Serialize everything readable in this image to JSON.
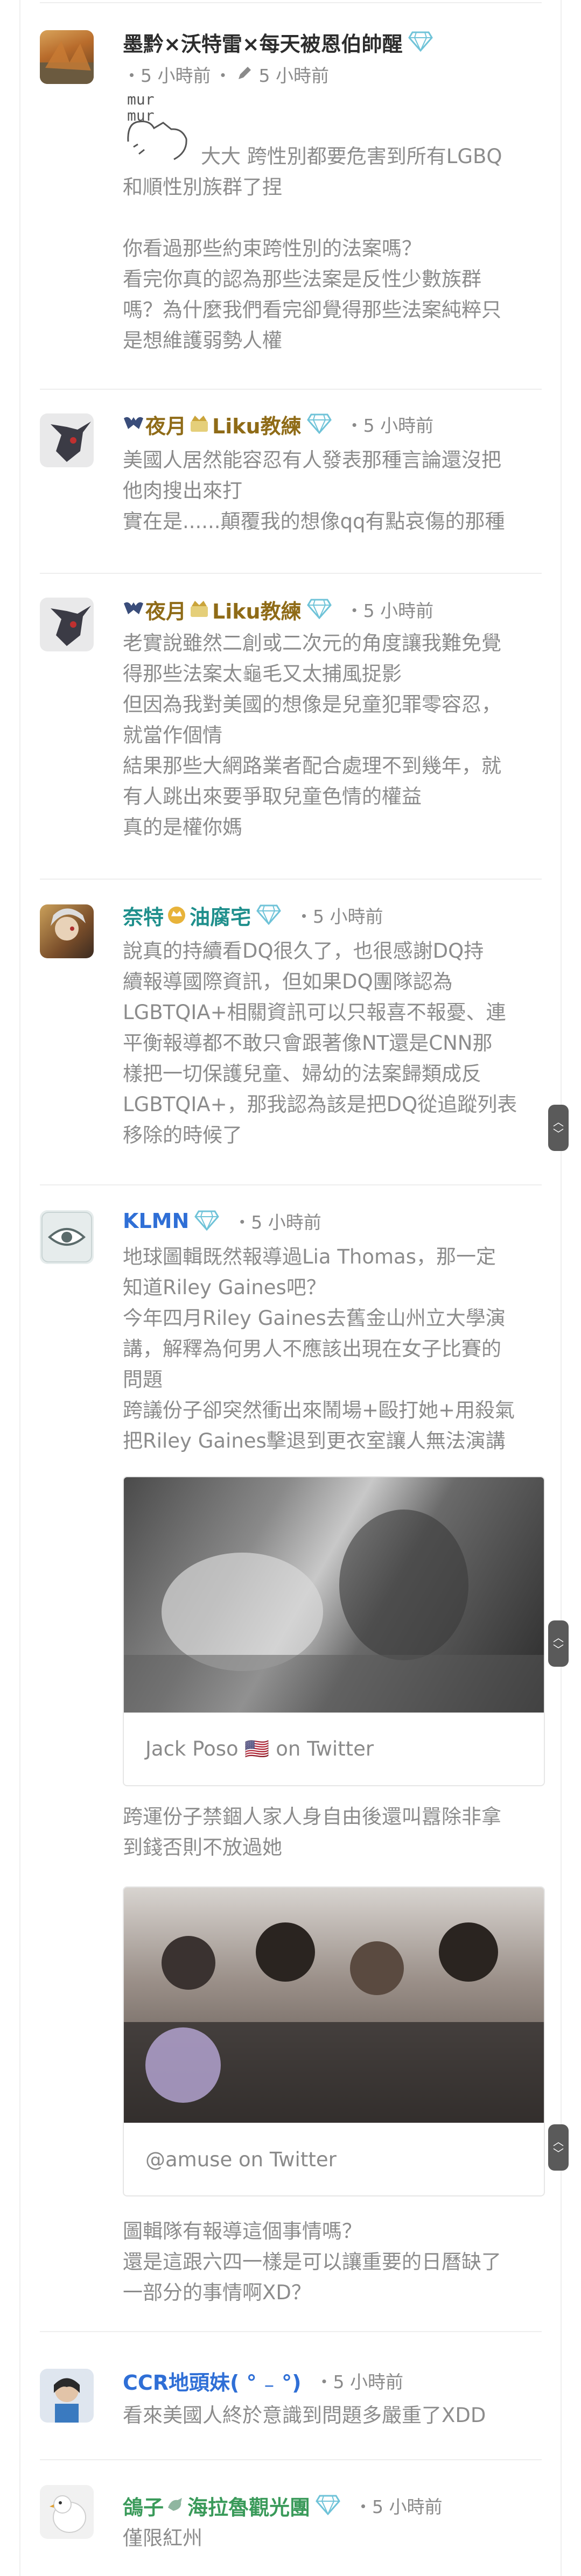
{
  "posts": [
    {
      "name": "墨黔×沃特雷×每天被恩伯帥醒",
      "edited_time": "5 小時前",
      "time": "5 小時前",
      "sticker_text": "mur mur",
      "lines": [
        "大大 跨性別都要危害到所有LGBQ",
        "和順性別族群了捏",
        "",
        "你看過那些約束跨性別的法案嗎？",
        "看完你真的認為那些法案是反性少數族群",
        "嗎？為什麼我們看完卻覺得那些法案純粹只",
        "是想維護弱勢人權"
      ]
    },
    {
      "name": "夜月",
      "title_badge": "Liku教練",
      "time": "5 小時前",
      "lines": [
        "美國人居然能容忍有人發表那種言論還沒把",
        "他肉搜出來打",
        "實在是......顛覆我的想像qq有點哀傷的那種"
      ]
    },
    {
      "name": "夜月",
      "title_badge": "Liku教練",
      "time": "5 小時前",
      "lines": [
        "老實說雖然二創或二次元的角度讓我難免覺",
        "得那些法案太龜毛又太捕風捉影",
        "但因為我對美國的想像是兒童犯罪零容忍，",
        "就當作個情",
        "結果那些大網路業者配合處理不到幾年，就",
        "有人跳出來要爭取兒童色情的權益",
        "真的是權你媽"
      ]
    },
    {
      "name": "奈特",
      "title_badge": "油腐宅",
      "time": "5 小時前",
      "lines": [
        "說真的持續看DQ很久了，也很感謝DQ持",
        "續報導國際資訊，但如果DQ團隊認為",
        "LGBTQIA+相關資訊可以只報喜不報憂、連",
        "平衡報導都不敢只會跟著像NT還是CNN那",
        "樣把一切保護兒童、婦幼的法案歸類成反",
        "LGBTQIA+，那我認為該是把DQ從追蹤列表",
        "移除的時候了"
      ]
    },
    {
      "name": "KLMN",
      "time": "5 小時前",
      "lines": [
        "地球圖輯既然報導過Lia Thomas，那一定",
        "知道Riley Gaines吧？",
        "今年四月Riley Gaines去舊金山州立大學演",
        "講，解釋為何男人不應該出現在女子比賽的",
        "問題",
        "跨議份子卻突然衝出來鬧場+毆打她+用殺氣",
        "把Riley Gaines擊退到更衣室讓人無法演講"
      ],
      "embed1_caption": "Jack Poso 🇺🇸 on Twitter",
      "lines2": [
        "跨運份子禁錮人家人身自由後還叫囂除非拿",
        "到錢否則不放過她"
      ],
      "embed2_caption": "@amuse on Twitter",
      "lines3": [
        "圖輯隊有報導這個事情嗎？",
        "還是這跟六四一樣是可以讓重要的日曆缺了",
        "一部分的事情啊XD？"
      ]
    },
    {
      "name": "CCR地頭妹( ° ₋ °)",
      "time": "5 小時前",
      "lines": [
        "看來美國人終於意識到問題多嚴重了XDD"
      ]
    },
    {
      "name": "鴿子",
      "title_badge": "海拉魯觀光團",
      "time": "5 小時前",
      "lines": [
        "僅限紅州"
      ]
    }
  ],
  "colors": {
    "name_default": "#2d2d2d",
    "name_gold": "#8f6b17",
    "name_teal": "#1f8f8c",
    "name_blue": "#2f6fd6",
    "name_green": "#3a9a5a",
    "diamond": "#6fc3d8"
  },
  "icons": [
    "diamond-icon",
    "pencil-icon",
    "bat-wing-icon",
    "crown-badge-icon",
    "bird-icon",
    "chevron-up-icon",
    "chevron-down-icon"
  ]
}
